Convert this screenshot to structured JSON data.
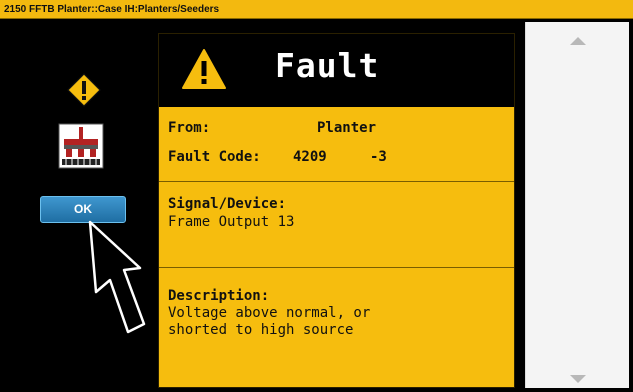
{
  "window": {
    "title": "2150 FFTB Planter::Case IH:Planters/Seeders"
  },
  "left_panel": {
    "warning_icon": "warning-diamond-icon",
    "planter_icon": "planter-icon",
    "ok_label": "OK"
  },
  "fault": {
    "title": "Fault",
    "from_label": "From:",
    "from_value": "Planter",
    "code_label": "Fault Code:",
    "code_value": "4209",
    "code_suffix": "-3",
    "signal_label": "Signal/Device:",
    "signal_value": "Frame Output 13",
    "description_label": "Description:",
    "description_line1": "Voltage above normal, or",
    "description_line2": "shorted to high source"
  },
  "colors": {
    "accent_yellow": "#f6bd0e",
    "title_bar": "#f3b90f",
    "ok_button": "#2a82bd",
    "background": "#000000"
  }
}
